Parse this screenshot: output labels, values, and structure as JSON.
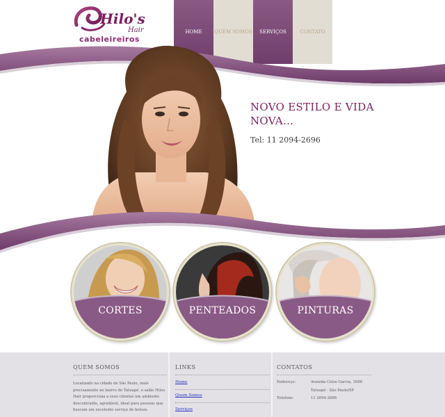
{
  "brand": {
    "logo_script": "Hilo's",
    "logo_hair": "Hair",
    "logo_sub": "cabeleireiros",
    "colors": {
      "primary": "#7a1f5e",
      "nav_dark": "#7b4a77",
      "nav_light": "#e2ddd2",
      "wave": "#8c5a86"
    }
  },
  "nav": {
    "items": [
      {
        "label": "HOME",
        "style": "dark"
      },
      {
        "label": "QUEM SOMOS",
        "style": "light"
      },
      {
        "label": "SERVIÇOS",
        "style": "dark"
      },
      {
        "label": "CONTATO",
        "style": "light"
      }
    ]
  },
  "hero": {
    "title": "NOVO ESTILO E VIDA NOVA...",
    "phone": "Tel: 11 2094-2696"
  },
  "services": [
    {
      "label": "CORTES",
      "icon": "blonde-woman-smiling-photo"
    },
    {
      "label": "PENTEADOS",
      "icon": "red-hair-profile-photo"
    },
    {
      "label": "PINTURAS",
      "icon": "hair-coloring-photo"
    }
  ],
  "footer": {
    "about": {
      "title": "QUEM SOMOS",
      "text": "Localizado na cidade de São Paulo, mais precisamente no bairro do Tatuapé, o salão Hilos Hair proporciona a seus clientes um ambiente descontraído, agradável, ideal para pessoas que buscam um excelente serviço de beleza."
    },
    "links": {
      "title": "LINKS",
      "items": [
        "Home",
        "Quem Somos",
        "Serviços"
      ]
    },
    "contacts": {
      "title": "CONTATOS",
      "address_label": "Endereço:",
      "address_line1": "Avenida Celso Garcia, 3988",
      "address_line2": "Tatuapé - São Paulo/SP",
      "phone_label": "Telefone:",
      "phone_value": "11 2094-2696"
    }
  }
}
